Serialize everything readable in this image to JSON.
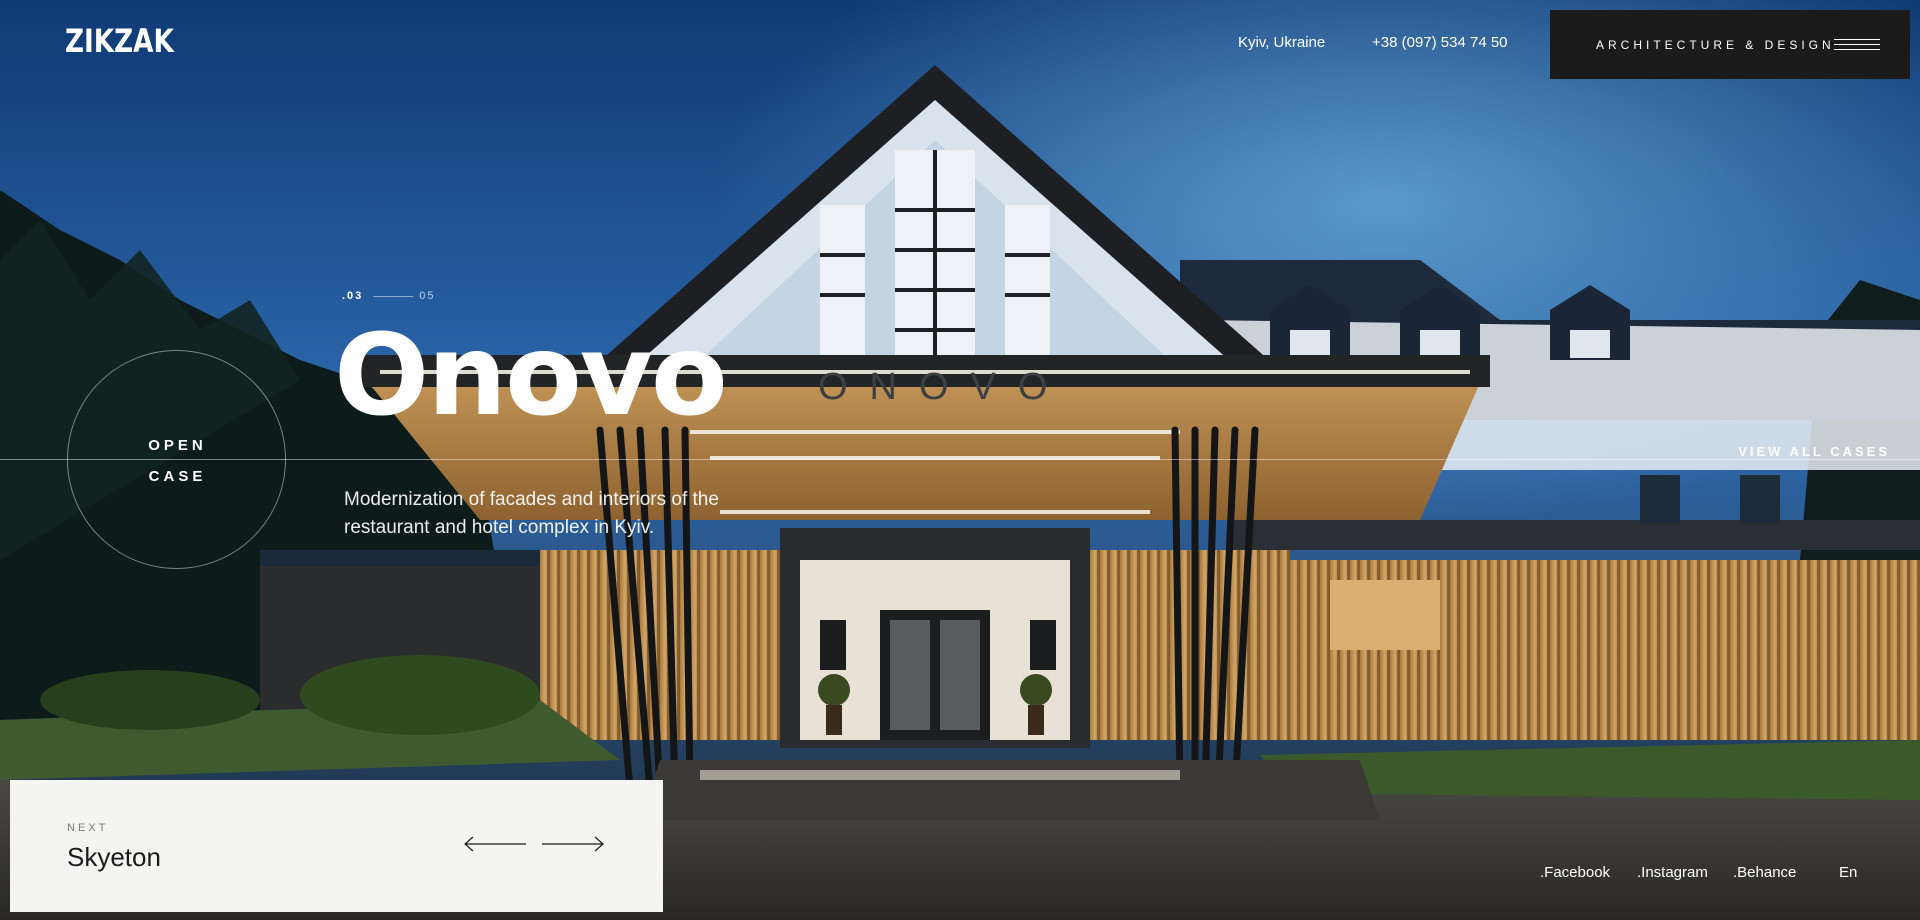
{
  "header": {
    "logo": "ZIKZAK",
    "city": "Kyiv, Ukraine",
    "phone": "+38 (097) 534 74 50",
    "menu_label": "ARCHITECTURE & DESIGN",
    "menu_icon": "hamburger-icon"
  },
  "slider": {
    "current": ".03",
    "total": "05",
    "title": "Onovo",
    "sign_text": "ONOVO",
    "description": "Modernization of facades and interiors of the restaurant and hotel complex in Kyiv.",
    "open_case_line1": "OPEN",
    "open_case_line2": "CASE",
    "view_all": "VIEW ALL CASES"
  },
  "next": {
    "label": "NEXT",
    "title": "Skyeton",
    "prev_icon": "arrow-left-icon",
    "next_icon": "arrow-right-icon"
  },
  "footer": {
    "facebook": ".Facebook",
    "instagram": ".Instagram",
    "behance": ".Behance",
    "language": "En"
  },
  "colors": {
    "sky_top": "#0f3a74",
    "sky_mid": "#2f6fb5",
    "dark_panel": "#1b1b1b",
    "card_bg": "#f4f4f2",
    "text_light": "#ffffff"
  }
}
